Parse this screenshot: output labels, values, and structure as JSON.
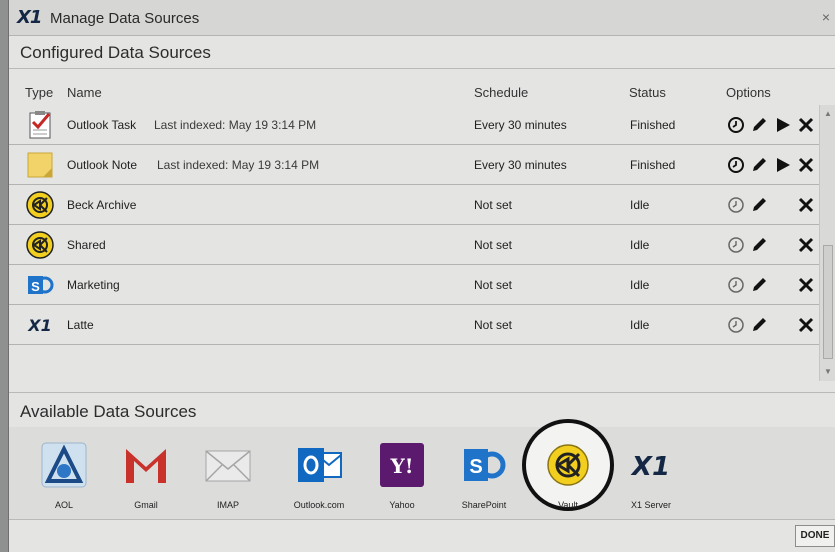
{
  "window": {
    "logo": "X1",
    "title": "Manage Data Sources",
    "close_glyph": "×"
  },
  "configured": {
    "title": "Configured Data Sources",
    "columns": {
      "type": "Type",
      "name": "Name",
      "schedule": "Schedule",
      "status": "Status",
      "options": "Options"
    },
    "rows": [
      {
        "icon": "outlook-task-icon",
        "name": "Outlook Task",
        "last_indexed": "Last indexed: May 19 3:14 PM",
        "schedule": "Every 30 minutes",
        "status": "Finished",
        "run_enabled": true
      },
      {
        "icon": "outlook-note-icon",
        "name": "Outlook Note",
        "last_indexed": "Last indexed: May 19 3:14 PM",
        "schedule": "Every 30 minutes",
        "status": "Finished",
        "run_enabled": true
      },
      {
        "icon": "vault-icon",
        "name": "Beck Archive",
        "last_indexed": "",
        "schedule": "Not set",
        "status": "Idle",
        "run_enabled": false
      },
      {
        "icon": "vault-icon",
        "name": "Shared",
        "last_indexed": "",
        "schedule": "Not set",
        "status": "Idle",
        "run_enabled": false
      },
      {
        "icon": "sharepoint-icon",
        "name": "Marketing",
        "last_indexed": "",
        "schedule": "Not set",
        "status": "Idle",
        "run_enabled": false
      },
      {
        "icon": "x1-icon",
        "name": "Latte",
        "last_indexed": "",
        "schedule": "Not set",
        "status": "Idle",
        "run_enabled": false
      }
    ]
  },
  "available": {
    "title": "Available Data Sources",
    "tiles": [
      {
        "label": "AOL",
        "icon": "aol-icon"
      },
      {
        "label": "Gmail",
        "icon": "gmail-icon"
      },
      {
        "label": "IMAP",
        "icon": "imap-icon"
      },
      {
        "label": "Outlook.com",
        "icon": "outlook-com-icon"
      },
      {
        "label": "Yahoo",
        "icon": "yahoo-icon"
      },
      {
        "label": "SharePoint",
        "icon": "sharepoint-icon"
      },
      {
        "label": "Vault",
        "icon": "vault-icon",
        "highlighted": true
      },
      {
        "label": "X1 Server",
        "icon": "x1-server-icon"
      }
    ]
  },
  "footer": {
    "done_label": "DONE"
  },
  "colors": {
    "vault_yellow": "#f2cf1f",
    "x1_navy": "#142846",
    "sharepoint_blue": "#1f73c9",
    "gmail_red": "#c8322a",
    "yahoo_purple": "#5c1a6e",
    "outlook_blue": "#1168c1"
  }
}
